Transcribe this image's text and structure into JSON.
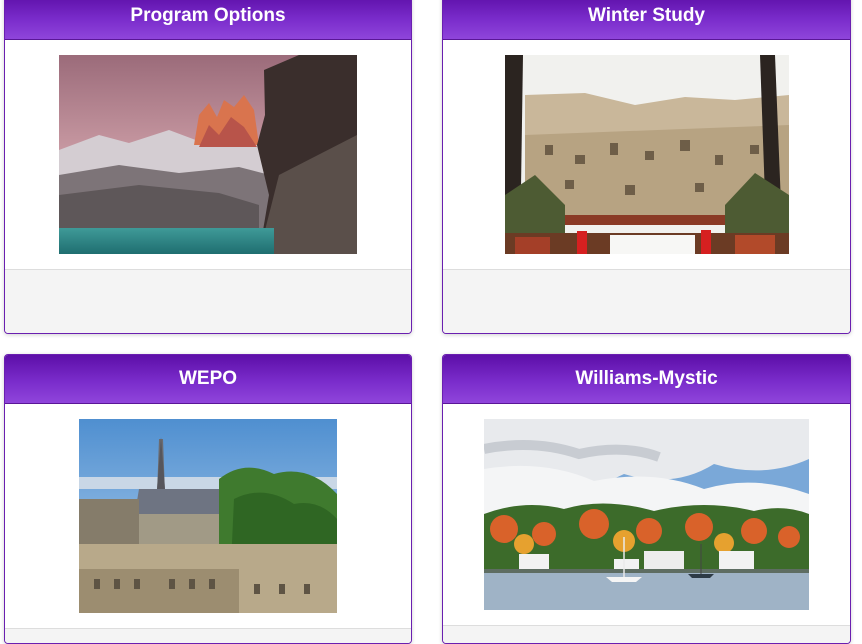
{
  "panels": [
    {
      "title": "Program Options",
      "image_alt": "Torres del Paine peaks above a turquoise lake"
    },
    {
      "title": "Winter Study",
      "image_alt": "Stone cave dwellings of Matera seen from a terrace"
    },
    {
      "title": "WEPO",
      "image_alt": "Oxford spires and college rooftops among trees"
    },
    {
      "title": "Williams-Mystic",
      "image_alt": "Autumn shoreline with white houses and boats under clouds"
    }
  ],
  "colors": {
    "header_top": "#5d0fa8",
    "header_bottom": "#8f45db",
    "border": "#6a1fb0",
    "footer": "#f4f4f4"
  }
}
